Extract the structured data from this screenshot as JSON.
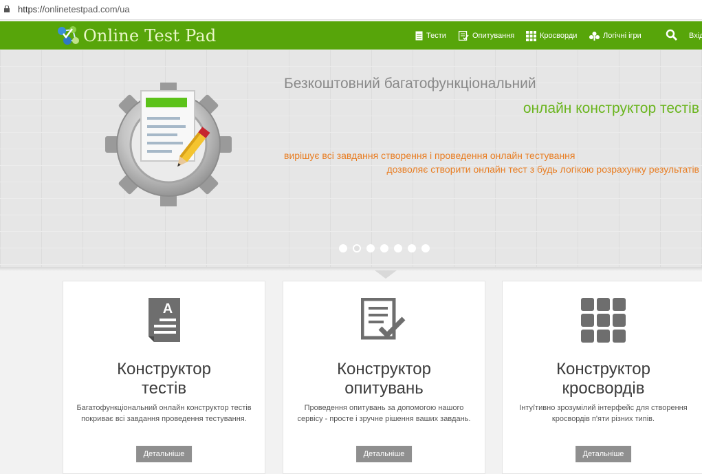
{
  "browser": {
    "url_scheme": "https://",
    "url_host": "onlinetestpad.com/ua"
  },
  "header": {
    "logo_text": "Online Test Pad",
    "nav": [
      {
        "label": "Тести",
        "icon": "document-icon"
      },
      {
        "label": "Опитування",
        "icon": "checklist-icon"
      },
      {
        "label": "Кросворди",
        "icon": "grid-icon"
      },
      {
        "label": "Логічні ігри",
        "icon": "puzzle-icon"
      }
    ],
    "search_icon": "search-icon",
    "login_label": "Вхід"
  },
  "hero": {
    "title": "Безкоштовний багатофункціональний",
    "subtitle": "онлайн конструктор тестів",
    "line1": "вирішує всі завдання створення і проведення онлайн тестування",
    "line2": "дозволяє створити онлайн тест з будь логікою розрахунку результатів",
    "slides": 7,
    "active_slide": 2
  },
  "cards": [
    {
      "icon": "test-document-icon",
      "title_line1": "Конструктор",
      "title_line2": "тестів",
      "desc_line1": "Багатофункціональний онлайн конструктор тестів",
      "desc_line2": "покриває всі завдання проведення тестування.",
      "button": "Детальніше"
    },
    {
      "icon": "survey-checklist-icon",
      "title_line1": "Конструктор",
      "title_line2": "опитувань",
      "desc_line1": "Проведення опитувань за допомогою нашого",
      "desc_line2": "сервісу - просте і зручне рішення ваших завдань.",
      "button": "Детальніше"
    },
    {
      "icon": "crossword-grid-icon",
      "title_line1": "Конструктор",
      "title_line2": "кросвордів",
      "desc_line1": "Інтуїтивно зрозумілий інтерфейс для створення",
      "desc_line2": "кросвордів п'яти різних типів.",
      "button": "Детальніше"
    }
  ],
  "colors": {
    "nav_green": "#57a50a",
    "hero_green": "#6ab51e",
    "hero_orange": "#e87d22",
    "button_gray": "#8f8f8f"
  }
}
